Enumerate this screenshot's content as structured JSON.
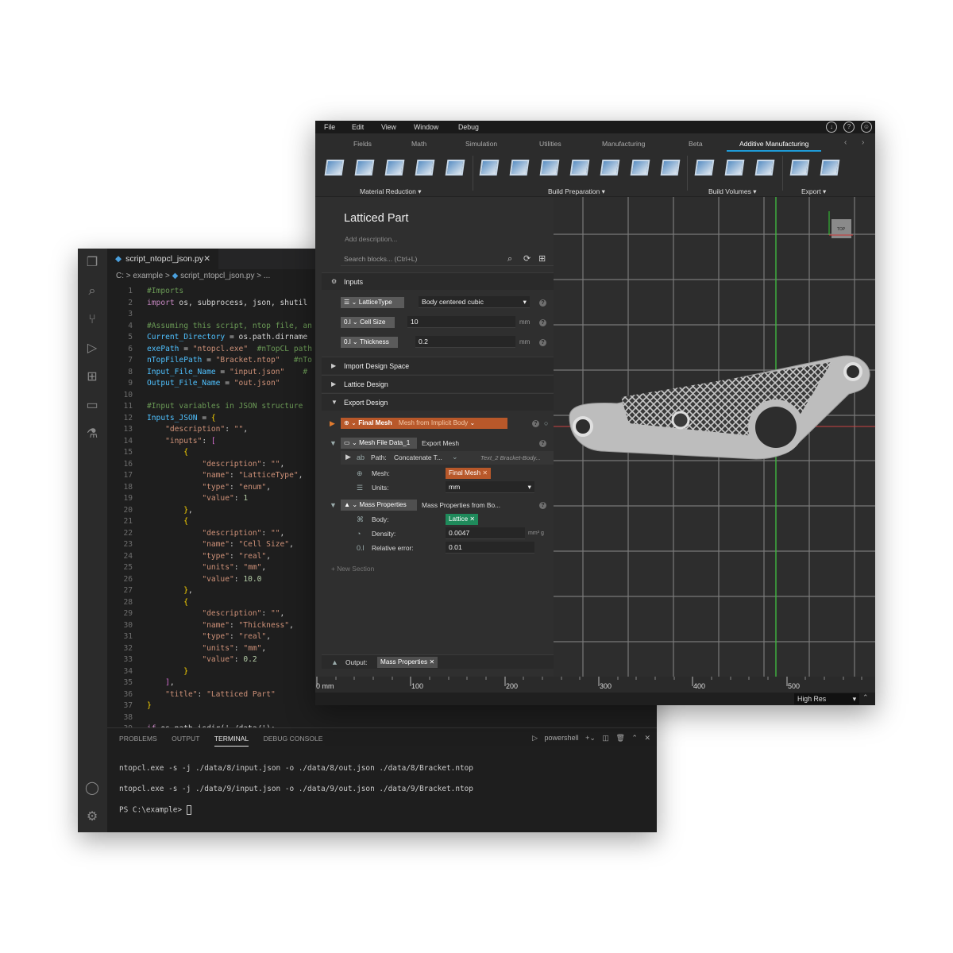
{
  "vscode": {
    "tab_label": "script_ntopcl_json.py",
    "breadcrumb": [
      "C:",
      "example",
      "script_ntopcl_json.py",
      "..."
    ],
    "code_lines": [
      "#Imports",
      "import os, subprocess, json, shutil",
      "",
      "#Assuming this script, ntop file, an",
      "Current_Directory = os.path.dirname",
      "exePath = \"ntopcl.exe\"  #nTopCL path",
      "nTopFilePath = \"Bracket.ntop\"   #nTo",
      "Input_File_Name = \"input.json\"    #",
      "Output_File_Name = \"out.json\"",
      "",
      "#Input variables in JSON structure",
      "Inputs_JSON = {",
      "    \"description\": \"\",",
      "    \"inputs\": [",
      "        {",
      "            \"description\": \"\",",
      "            \"name\": \"LatticeType\",",
      "            \"type\": \"enum\",",
      "            \"value\": 1",
      "        },",
      "        {",
      "            \"description\": \"\",",
      "            \"name\": \"Cell Size\",",
      "            \"type\": \"real\",",
      "            \"units\": \"mm\",",
      "            \"value\": 10.0",
      "        },",
      "        {",
      "            \"description\": \"\",",
      "            \"name\": \"Thickness\",",
      "            \"type\": \"real\",",
      "            \"units\": \"mm\",",
      "            \"value\": 0.2",
      "        }",
      "    ],",
      "    \"title\": \"Latticed Part\"",
      "}",
      "",
      "if os.path.isdir('./data/'):"
    ],
    "panel_tabs": [
      "PROBLEMS",
      "OUTPUT",
      "TERMINAL",
      "DEBUG CONSOLE"
    ],
    "active_panel_tab": "TERMINAL",
    "shell_label": "powershell",
    "terminal_lines": [
      "ntopcl.exe -s -j ./data/8/input.json -o ./data/8/out.json ./data/8/Bracket.ntop",
      "ntopcl.exe -s -j ./data/9/input.json -o ./data/9/out.json ./data/9/Bracket.ntop",
      "PS C:\\example> "
    ]
  },
  "ntop": {
    "menu": [
      "File",
      "Edit",
      "View",
      "Window",
      "Debug"
    ],
    "ribbon_tabs": [
      "Fields",
      "Math",
      "Simulation",
      "Utilities",
      "Manufacturing",
      "Beta",
      "Additive Manufacturing"
    ],
    "active_ribbon_tab": "Additive Manufacturing",
    "ribbon_groups": [
      "Material Reduction",
      "Build Preparation",
      "Build Volumes",
      "Export"
    ],
    "notebook": {
      "title": "Latticed Part",
      "description_placeholder": "Add description...",
      "search_placeholder": "Search blocks... (Ctrl+L)",
      "sections": [
        "Inputs",
        "Import Design Space",
        "Lattice Design",
        "Export Design"
      ],
      "inputs": [
        {
          "name": "LatticeType",
          "value": "Body centered cubic",
          "unit": ""
        },
        {
          "name": "Cell Size",
          "value": "10",
          "unit": "mm"
        },
        {
          "name": "Thickness",
          "value": "0.2",
          "unit": "mm"
        }
      ],
      "final_mesh": {
        "name": "Final Mesh",
        "type": "Mesh from Implicit Body"
      },
      "mesh_file": {
        "name": "Mesh File Data_1",
        "type": "Export Mesh",
        "path_label": "Path:",
        "path_value": "Concatenate T...",
        "path_hint": "Text_2  Bracket-Body...",
        "mesh_label": "Mesh:",
        "mesh_value": "Final Mesh",
        "units_label": "Units:",
        "units_value": "mm"
      },
      "mass_props": {
        "name": "Mass Properties",
        "type": "Mass Properties from Bo...",
        "body_label": "Body:",
        "body_value": "Lattice",
        "density_label": "Density:",
        "density_value": "0.0047",
        "density_unit": "mm³ g",
        "relerr_label": "Relative error:",
        "relerr_value": "0.01"
      },
      "new_section": "+ New Section",
      "output_label": "Output:",
      "output_value": "Mass Properties"
    },
    "ruler_labels": [
      "0 mm",
      "100",
      "200",
      "300",
      "400",
      "500"
    ],
    "view_cube_label": "TOP",
    "render_quality": "High Res"
  },
  "colors": {
    "accent_blue": "#1e9bd7",
    "orange_chip": "#c8642a",
    "green_chip": "#1f8a5b"
  }
}
